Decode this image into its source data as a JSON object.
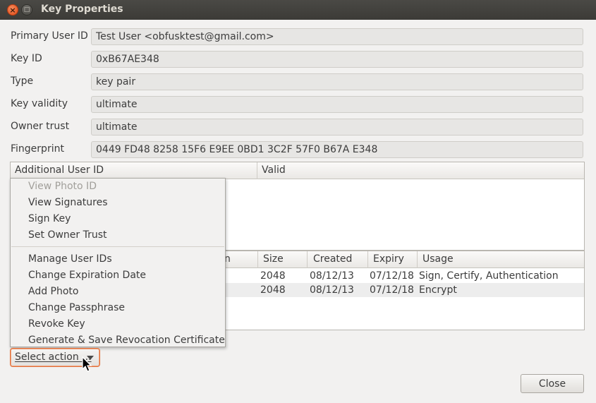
{
  "window": {
    "title": "Key Properties"
  },
  "fields": [
    {
      "label": "Primary User ID",
      "value": "Test User <obfusktest@gmail.com>"
    },
    {
      "label": "Key ID",
      "value": "0xB67AE348"
    },
    {
      "label": "Type",
      "value": "key pair"
    },
    {
      "label": "Key validity",
      "value": "ultimate"
    },
    {
      "label": "Owner trust",
      "value": "ultimate"
    },
    {
      "label": "Fingerprint",
      "value": "0449 FD48 8258 15F6 E9EE 0BD1 3C2F 57F0 B67A E348"
    }
  ],
  "uid_table": {
    "headers": [
      "Additional User ID",
      "Valid"
    ]
  },
  "subkey_table": {
    "headers": [
      "n",
      "Size",
      "Created",
      "Expiry",
      "Usage"
    ],
    "rows": [
      {
        "size": "2048",
        "created": "08/12/13",
        "expiry": "07/12/18",
        "usage": "Sign, Certify, Authentication"
      },
      {
        "size": "2048",
        "created": "08/12/13",
        "expiry": "07/12/18",
        "usage": "Encrypt"
      }
    ]
  },
  "menu": {
    "items": [
      {
        "label": "View Photo ID",
        "enabled": false
      },
      {
        "label": "View Signatures",
        "enabled": true
      },
      {
        "label": "Sign Key",
        "enabled": true
      },
      {
        "label": "Set Owner Trust",
        "enabled": true
      },
      {
        "label": "Manage User IDs",
        "enabled": true
      },
      {
        "label": "Change Expiration Date",
        "enabled": true
      },
      {
        "label": "Add Photo",
        "enabled": true
      },
      {
        "label": "Change Passphrase",
        "enabled": true
      },
      {
        "label": "Revoke Key",
        "enabled": true
      },
      {
        "label": "Generate & Save Revocation Certificate",
        "enabled": true
      }
    ]
  },
  "action_combo": {
    "label": "Select action ..."
  },
  "buttons": {
    "close": "Close"
  }
}
